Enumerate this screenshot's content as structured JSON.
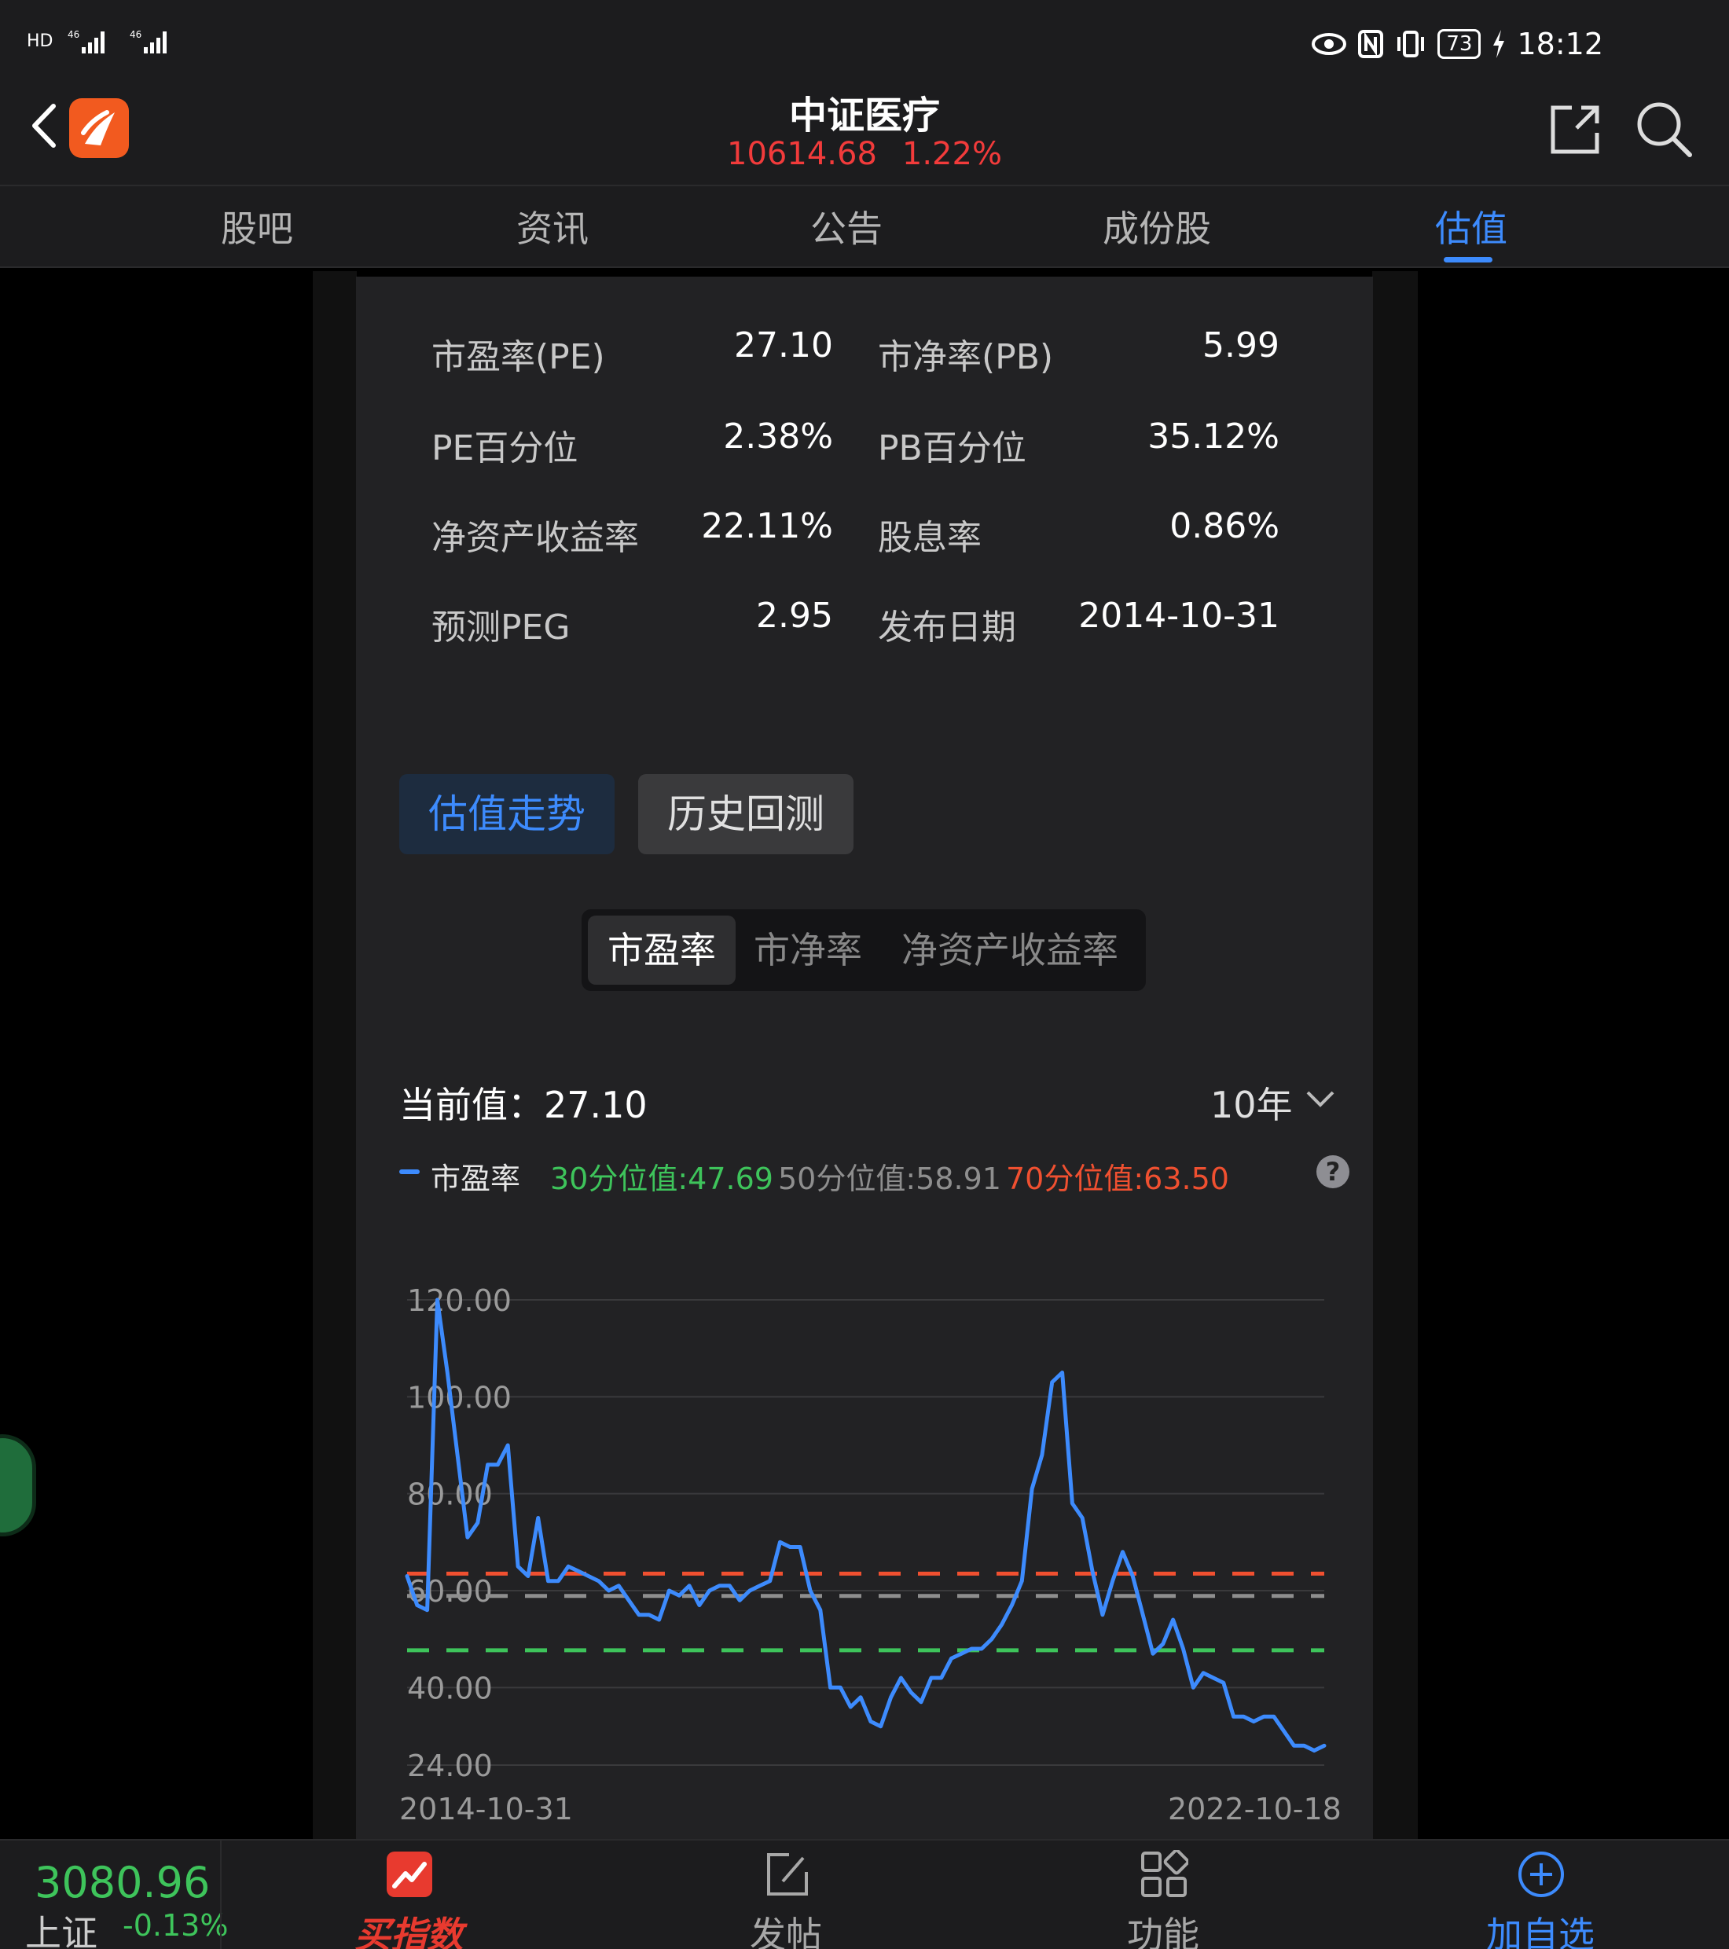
{
  "status_bar": {
    "left_indicators": [
      "HD",
      "46",
      "46"
    ],
    "battery": "73",
    "time": "18:12"
  },
  "header": {
    "title": "中证医疗",
    "price": "10614.68",
    "change": "1.22%",
    "icons": [
      "back-icon",
      "app-logo",
      "share-icon",
      "search-icon"
    ]
  },
  "tabs": [
    {
      "label": "股吧",
      "active": false
    },
    {
      "label": "资讯",
      "active": false
    },
    {
      "label": "公告",
      "active": false
    },
    {
      "label": "成份股",
      "active": false
    },
    {
      "label": "估值",
      "active": true
    }
  ],
  "metrics": [
    {
      "label": "市盈率(PE)",
      "value": "27.10"
    },
    {
      "label": "市净率(PB)",
      "value": "5.99"
    },
    {
      "label": "PE百分位",
      "value": "2.38%"
    },
    {
      "label": "PB百分位",
      "value": "35.12%"
    },
    {
      "label": "净资产收益率",
      "value": "22.11%"
    },
    {
      "label": "股息率",
      "value": "0.86%"
    },
    {
      "label": "预测PEG",
      "value": "2.95"
    },
    {
      "label": "发布日期",
      "value": "2014-10-31"
    }
  ],
  "view_tabs": [
    {
      "label": "估值走势",
      "active": true
    },
    {
      "label": "历史回测",
      "active": false
    }
  ],
  "segments": [
    {
      "label": "市盈率",
      "active": true
    },
    {
      "label": "市净率",
      "active": false
    },
    {
      "label": "净资产收益率",
      "active": false
    }
  ],
  "current_value": "当前值：27.10",
  "range_select": "10年",
  "legend": {
    "series": "市盈率",
    "p30": "30分位值:47.69",
    "p50": "50分位值:58.91",
    "p70": "70分位值:63.50",
    "help": "?"
  },
  "colors": {
    "accent": "#3d8bfd",
    "up": "#f23b3b",
    "down": "#3ec45b",
    "p30": "#3ec45b",
    "p50": "#8e8e8e",
    "p70": "#f05030"
  },
  "chart_data": {
    "type": "line",
    "x_start_label": "2014-10-31",
    "x_end_label": "2022-10-18",
    "ylim": [
      24,
      120
    ],
    "y_ticks": [
      "120.00",
      "100.00",
      "80.00",
      "60.00",
      "40.00",
      "24.00"
    ],
    "y_tick_values": [
      120,
      100,
      80,
      60,
      40,
      24
    ],
    "grid": true,
    "reference_lines": [
      {
        "name": "70分位值",
        "value": 63.5,
        "color": "#f05030"
      },
      {
        "name": "50分位值",
        "value": 58.91,
        "color": "#8e8e8e"
      },
      {
        "name": "30分位值",
        "value": 47.69,
        "color": "#3ec45b"
      }
    ],
    "series": [
      {
        "name": "市盈率",
        "color": "#3d8bfd",
        "values": [
          63,
          57,
          56,
          120,
          105,
          88,
          71,
          74,
          86,
          86,
          90,
          65,
          63,
          75,
          62,
          62,
          65,
          64,
          63,
          62,
          60,
          61,
          58,
          55,
          55,
          54,
          60,
          59,
          61,
          57,
          60,
          61,
          61,
          58,
          60,
          61,
          62,
          70,
          69,
          69,
          60,
          56,
          40,
          40,
          36,
          38,
          33,
          32,
          38,
          42,
          39,
          37,
          42,
          42,
          46,
          47,
          48,
          48,
          50,
          53,
          57,
          62,
          81,
          88,
          103,
          105,
          78,
          75,
          64,
          55,
          62,
          68,
          63,
          55,
          47,
          49,
          54,
          48,
          40,
          43,
          42,
          41,
          34,
          34,
          33,
          34,
          34,
          31,
          28,
          28,
          27,
          28
        ]
      }
    ]
  },
  "bottom_bar": {
    "index_value": "3080.96",
    "index_name": "上证",
    "index_change": "-0.13%",
    "items": [
      {
        "label": "买指数",
        "icon": "trend-chart-icon"
      },
      {
        "label": "发帖",
        "icon": "edit-icon"
      },
      {
        "label": "功能",
        "icon": "grid-icon"
      },
      {
        "label": "加自选",
        "icon": "add-circle-icon"
      }
    ]
  }
}
